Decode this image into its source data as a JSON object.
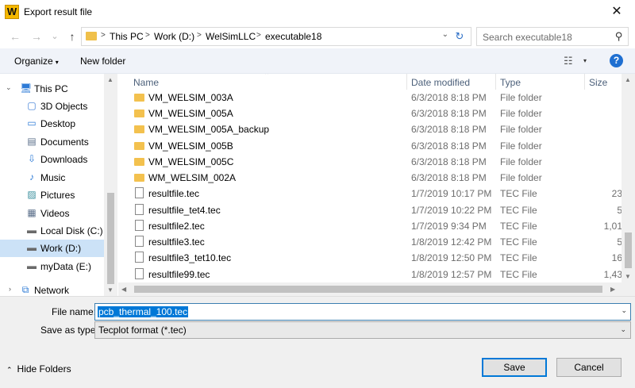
{
  "window": {
    "app_icon_letter": "W",
    "title": "Export result file",
    "close_glyph": "✕"
  },
  "navigation": {
    "back_glyph": "←",
    "forward_glyph": "→",
    "recent_glyph": "⌄",
    "up_glyph": "↑",
    "breadcrumb": [
      "This PC",
      "Work (D:)",
      "WelSimLLC",
      "executable18"
    ],
    "separator": ">",
    "dropdown_glyph": "⌄",
    "refresh_glyph": "↻",
    "search_placeholder": "Search executable18",
    "search_glyph": "⚲"
  },
  "toolbar": {
    "organize_label": "Organize",
    "organize_caret": "▾",
    "new_folder_label": "New folder",
    "view_glyph": "☷",
    "view_caret": "▾",
    "help_glyph": "?"
  },
  "sidebar": {
    "items": [
      {
        "label": "This PC",
        "icon": "computer-icon",
        "glyph": "🖥",
        "expander": "⌄"
      },
      {
        "label": "3D Objects",
        "icon": "3d-objects-icon",
        "glyph": "▢"
      },
      {
        "label": "Desktop",
        "icon": "desktop-icon",
        "glyph": "▭"
      },
      {
        "label": "Documents",
        "icon": "documents-icon",
        "glyph": "▤"
      },
      {
        "label": "Downloads",
        "icon": "downloads-icon",
        "glyph": "⇩"
      },
      {
        "label": "Music",
        "icon": "music-icon",
        "glyph": "♪"
      },
      {
        "label": "Pictures",
        "icon": "pictures-icon",
        "glyph": "▨"
      },
      {
        "label": "Videos",
        "icon": "videos-icon",
        "glyph": "▦"
      },
      {
        "label": "Local Disk (C:)",
        "icon": "drive-icon",
        "glyph": "▬"
      },
      {
        "label": "Work (D:)",
        "icon": "drive-icon",
        "glyph": "▬"
      },
      {
        "label": "myData (E:)",
        "icon": "drive-icon",
        "glyph": "▬"
      },
      {
        "label": "Network",
        "icon": "network-icon",
        "glyph": "⧉",
        "expander": "›"
      }
    ],
    "selected_index": 9,
    "scroll_up_glyph": "▲",
    "scroll_down_glyph": "▼"
  },
  "file_list": {
    "columns": {
      "name": "Name",
      "date": "Date modified",
      "type": "Type",
      "size": "Size"
    },
    "sort_glyph": "⌃",
    "rows": [
      {
        "name": "VM_WELSIM_003A",
        "date": "6/3/2018 8:18 PM",
        "type": "File folder",
        "size": "",
        "kind": "folder"
      },
      {
        "name": "VM_WELSIM_005A",
        "date": "6/3/2018 8:18 PM",
        "type": "File folder",
        "size": "",
        "kind": "folder"
      },
      {
        "name": "VM_WELSIM_005A_backup",
        "date": "6/3/2018 8:18 PM",
        "type": "File folder",
        "size": "",
        "kind": "folder"
      },
      {
        "name": "VM_WELSIM_005B",
        "date": "6/3/2018 8:18 PM",
        "type": "File folder",
        "size": "",
        "kind": "folder"
      },
      {
        "name": "VM_WELSIM_005C",
        "date": "6/3/2018 8:18 PM",
        "type": "File folder",
        "size": "",
        "kind": "folder"
      },
      {
        "name": "WM_WELSIM_002A",
        "date": "6/3/2018 8:18 PM",
        "type": "File folder",
        "size": "",
        "kind": "folder"
      },
      {
        "name": "resultfile.tec",
        "date": "1/7/2019 10:17 PM",
        "type": "TEC File",
        "size": "23",
        "kind": "file"
      },
      {
        "name": "resultfile_tet4.tec",
        "date": "1/7/2019 10:22 PM",
        "type": "TEC File",
        "size": "5",
        "kind": "file"
      },
      {
        "name": "resultfile2.tec",
        "date": "1/7/2019 9:34 PM",
        "type": "TEC File",
        "size": "1,01",
        "kind": "file"
      },
      {
        "name": "resultfile3.tec",
        "date": "1/8/2019 12:42 PM",
        "type": "TEC File",
        "size": "5",
        "kind": "file"
      },
      {
        "name": "resultfile3_tet10.tec",
        "date": "1/8/2019 12:50 PM",
        "type": "TEC File",
        "size": "16",
        "kind": "file"
      },
      {
        "name": "resultfile99.tec",
        "date": "1/8/2019 12:57 PM",
        "type": "TEC File",
        "size": "1,43",
        "kind": "file"
      }
    ],
    "scroll_up_glyph": "▲",
    "scroll_down_glyph": "▼",
    "scroll_left_glyph": "◀",
    "scroll_right_glyph": "▶"
  },
  "form": {
    "file_name_label": "File name:",
    "file_name_value": "pcb_thermal_100.tec",
    "save_as_type_label": "Save as type:",
    "save_as_type_value": "Tecplot format (*.tec)",
    "dropdown_glyph": "⌄",
    "hide_folders_glyph": "⌃",
    "hide_folders_label": "Hide Folders",
    "save_label": "Save",
    "cancel_label": "Cancel"
  },
  "colors": {
    "accent": "#0078d7",
    "folder": "#f3c14e",
    "selection": "#cce2f7",
    "header_text": "#4c607a"
  }
}
